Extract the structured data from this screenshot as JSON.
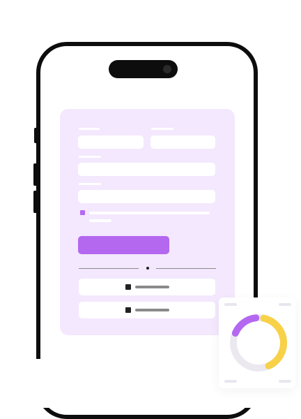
{
  "colors": {
    "phone_frame": "#0d0d0d",
    "card_background": "#f3e8fd",
    "accent": "#b468f0",
    "progress_yellow": "#f7d148",
    "progress_purple": "#b468f0",
    "progress_track": "#ebe9ef"
  },
  "form": {
    "fields": [
      "first-name",
      "last-name",
      "field-2",
      "field-3"
    ],
    "checkbox_checked": true
  },
  "progress_widget": {
    "segments": [
      {
        "color": "yellow",
        "fraction": 0.4
      },
      {
        "color": "purple",
        "fraction": 0.17
      }
    ]
  }
}
